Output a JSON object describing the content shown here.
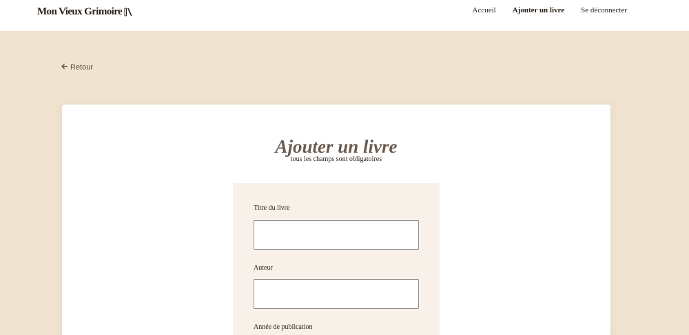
{
  "header": {
    "logo_text": "Mon Vieux Grimoire",
    "nav": {
      "home": "Accueil",
      "add_book": "Ajouter un livre",
      "logout": "Se déconnecter"
    }
  },
  "back_link": {
    "label": "Retour"
  },
  "form": {
    "title": "Ajouter un livre",
    "subtitle": "tous les champs sont obligatoires",
    "fields": {
      "title": {
        "label": "Titre du livre",
        "value": ""
      },
      "author": {
        "label": "Auteur",
        "value": ""
      },
      "year": {
        "label": "Année de publication"
      }
    }
  },
  "colors": {
    "page_background": "#f0e3cf",
    "panel_background": "#f7f1e9",
    "title_color": "#6b5b4f",
    "text_color": "#2b2118"
  }
}
